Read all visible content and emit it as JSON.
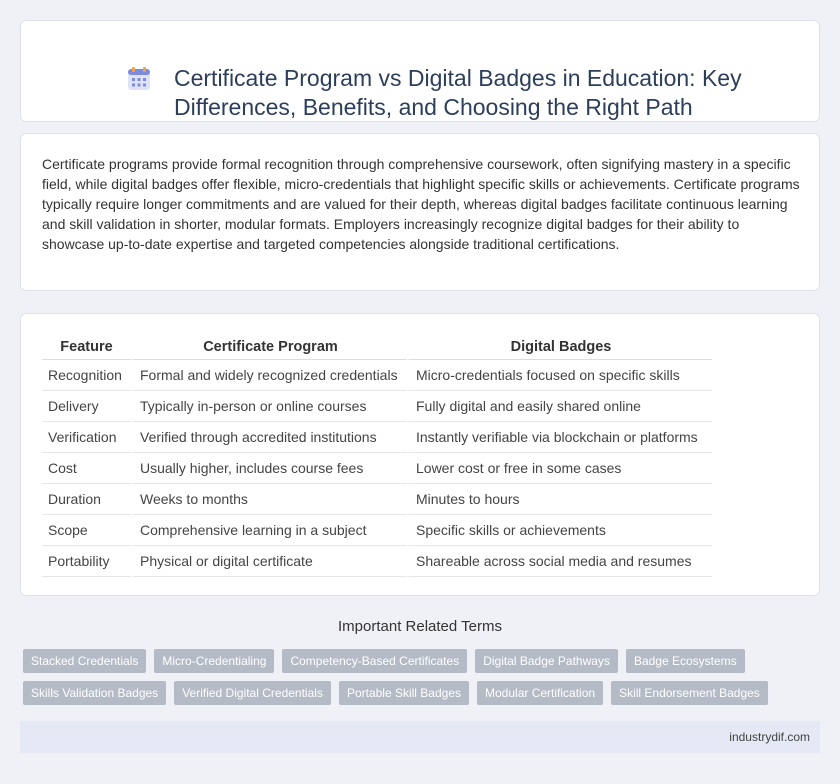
{
  "header": {
    "icon": "calendar-icon",
    "title": "Certificate Program vs Digital Badges in Education: Key Differences, Benefits, and Choosing the Right Path"
  },
  "intro": {
    "text": "Certificate programs provide formal recognition through comprehensive coursework, often signifying mastery in a specific field, while digital badges offer flexible, micro-credentials that highlight specific skills or achievements. Certificate programs typically require longer commitments and are valued for their depth, whereas digital badges facilitate continuous learning and skill validation in shorter, modular formats. Employers increasingly recognize digital badges for their ability to showcase up-to-date expertise and targeted competencies alongside traditional certifications."
  },
  "comparison": {
    "headers": [
      "Feature",
      "Certificate Program",
      "Digital Badges"
    ],
    "rows": [
      [
        "Recognition",
        "Formal and widely recognized credentials",
        "Micro-credentials focused on specific skills"
      ],
      [
        "Delivery",
        "Typically in-person or online courses",
        "Fully digital and easily shared online"
      ],
      [
        "Verification",
        "Verified through accredited institutions",
        "Instantly verifiable via blockchain or platforms"
      ],
      [
        "Cost",
        "Usually higher, includes course fees",
        "Lower cost or free in some cases"
      ],
      [
        "Duration",
        "Weeks to months",
        "Minutes to hours"
      ],
      [
        "Scope",
        "Comprehensive learning in a subject",
        "Specific skills or achievements"
      ],
      [
        "Portability",
        "Physical or digital certificate",
        "Shareable across social media and resumes"
      ]
    ]
  },
  "related": {
    "title": "Important Related Terms",
    "row1": [
      "Stacked Credentials",
      "Micro-Credentialing",
      "Competency-Based Certificates",
      "Digital Badge Pathways",
      "Badge Ecosystems"
    ],
    "row2": [
      "Skills Validation Badges",
      "Verified Digital Credentials",
      "Portable Skill Badges",
      "Modular Certification",
      "Skill Endorsement Badges"
    ]
  },
  "footer": {
    "site": "industrydif.com"
  },
  "colors": {
    "accent": "#2c3e5a",
    "tag_bg": "#b5bbc6",
    "footer_bg": "#e4e9f5",
    "page_bg": "#eff1f6"
  }
}
